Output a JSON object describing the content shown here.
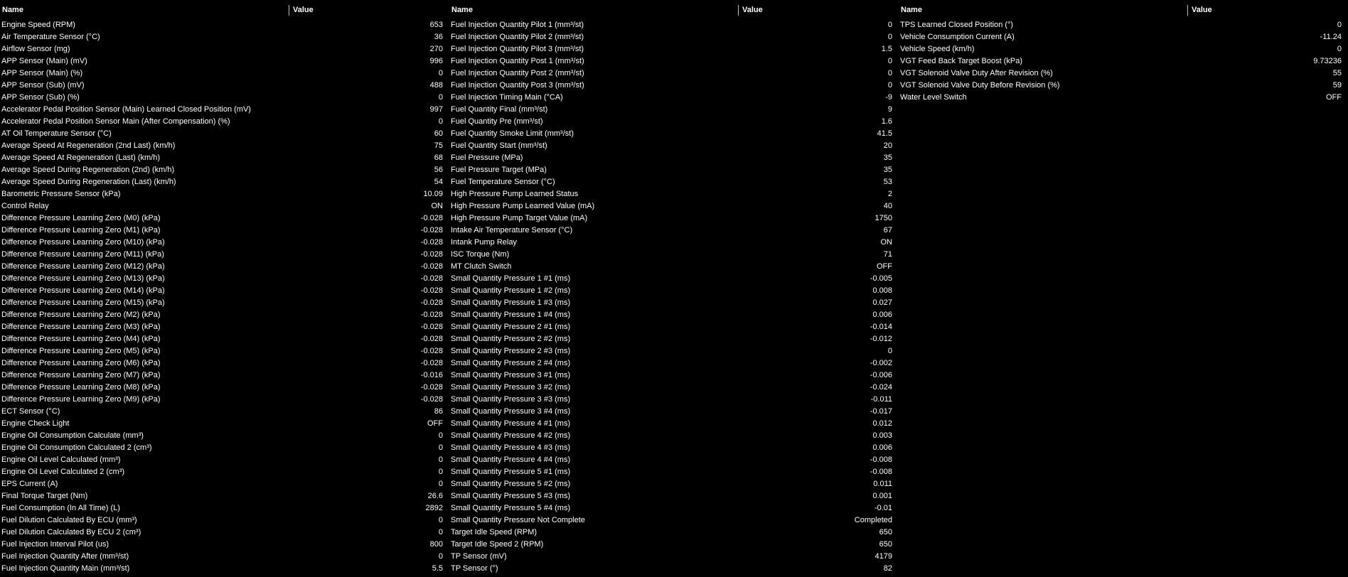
{
  "headers": {
    "name": "Name",
    "value": "Value"
  },
  "colors": {
    "background": "#000000",
    "text": "#ffffff"
  },
  "columns": [
    {
      "rows": [
        {
          "name": "Engine Speed (RPM)",
          "value": "653"
        },
        {
          "name": "Air Temperature Sensor (°C)",
          "value": "36"
        },
        {
          "name": "Airflow Sensor (mg)",
          "value": "270"
        },
        {
          "name": "APP Sensor (Main) (mV)",
          "value": "996"
        },
        {
          "name": "APP Sensor (Main) (%)",
          "value": "0"
        },
        {
          "name": "APP Sensor (Sub) (mV)",
          "value": "488"
        },
        {
          "name": "APP Sensor (Sub) (%)",
          "value": "0"
        },
        {
          "name": "Accelerator Pedal Position Sensor (Main) Learned Closed Position (mV)",
          "value": "997"
        },
        {
          "name": "Accelerator Pedal Position Sensor Main (After Compensation) (%)",
          "value": "0"
        },
        {
          "name": "AT Oil Temperature Sensor (°C)",
          "value": "60"
        },
        {
          "name": "Average Speed At Regeneration (2nd Last) (km/h)",
          "value": "75"
        },
        {
          "name": "Average Speed At Regeneration (Last) (km/h)",
          "value": "68"
        },
        {
          "name": "Average Speed During Regeneration (2nd) (km/h)",
          "value": "56"
        },
        {
          "name": "Average Speed During Regeneration (Last) (km/h)",
          "value": "54"
        },
        {
          "name": "Barometric Pressure Sensor (kPa)",
          "value": "10.09"
        },
        {
          "name": "Control Relay",
          "value": "ON"
        },
        {
          "name": "Difference Pressure Learning Zero (M0) (kPa)",
          "value": "-0.028"
        },
        {
          "name": "Difference Pressure Learning Zero (M1) (kPa)",
          "value": "-0.028"
        },
        {
          "name": "Difference Pressure Learning Zero (M10) (kPa)",
          "value": "-0.028"
        },
        {
          "name": "Difference Pressure Learning Zero (M11) (kPa)",
          "value": "-0.028"
        },
        {
          "name": "Difference Pressure Learning Zero (M12) (kPa)",
          "value": "-0.028"
        },
        {
          "name": "Difference Pressure Learning Zero (M13) (kPa)",
          "value": "-0.028"
        },
        {
          "name": "Difference Pressure Learning Zero (M14) (kPa)",
          "value": "-0.028"
        },
        {
          "name": "Difference Pressure Learning Zero (M15) (kPa)",
          "value": "-0.028"
        },
        {
          "name": "Difference Pressure Learning Zero (M2) (kPa)",
          "value": "-0.028"
        },
        {
          "name": "Difference Pressure Learning Zero (M3) (kPa)",
          "value": "-0.028"
        },
        {
          "name": "Difference Pressure Learning Zero (M4) (kPa)",
          "value": "-0.028"
        },
        {
          "name": "Difference Pressure Learning Zero (M5) (kPa)",
          "value": "-0.028"
        },
        {
          "name": "Difference Pressure Learning Zero (M6) (kPa)",
          "value": "-0.028"
        },
        {
          "name": "Difference Pressure Learning Zero (M7) (kPa)",
          "value": "-0.016"
        },
        {
          "name": "Difference Pressure Learning Zero (M8) (kPa)",
          "value": "-0.028"
        },
        {
          "name": "Difference Pressure Learning Zero (M9) (kPa)",
          "value": "-0.028"
        },
        {
          "name": "ECT Sensor (°C)",
          "value": "86"
        },
        {
          "name": "Engine Check Light",
          "value": "OFF"
        },
        {
          "name": "Engine Oil Consumption Calculate (mm³)",
          "value": "0"
        },
        {
          "name": "Engine Oil Consumption Calculated 2 (cm³)",
          "value": "0"
        },
        {
          "name": "Engine Oil Level Calculated (mm³)",
          "value": "0"
        },
        {
          "name": "Engine Oil Level Calculated 2 (cm³)",
          "value": "0"
        },
        {
          "name": "EPS Current (A)",
          "value": "0"
        },
        {
          "name": "Final Torque Target (Nm)",
          "value": "26.6"
        },
        {
          "name": "Fuel Consumption (In All Time) (L)",
          "value": "2892"
        },
        {
          "name": "Fuel Dilution Calculated By ECU (mm³)",
          "value": "0"
        },
        {
          "name": "Fuel Dilution Calculated By ECU 2 (cm³)",
          "value": "0"
        },
        {
          "name": "Fuel Injection Interval Pilot (us)",
          "value": "800"
        },
        {
          "name": "Fuel Injection Quantity After (mm³/st)",
          "value": "0"
        },
        {
          "name": "Fuel Injection Quantity Main (mm³/st)",
          "value": "5.5"
        }
      ]
    },
    {
      "rows": [
        {
          "name": "Fuel Injection Quantity Pilot 1 (mm³/st)",
          "value": "0"
        },
        {
          "name": "Fuel Injection Quantity Pilot 2 (mm³/st)",
          "value": "0"
        },
        {
          "name": "Fuel Injection Quantity Pilot 3 (mm³/st)",
          "value": "1.5"
        },
        {
          "name": "Fuel Injection Quantity Post 1 (mm³/st)",
          "value": "0"
        },
        {
          "name": "Fuel Injection Quantity Post 2 (mm³/st)",
          "value": "0"
        },
        {
          "name": "Fuel Injection Quantity Post 3 (mm³/st)",
          "value": "0"
        },
        {
          "name": "Fuel Injection Timing Main (°CA)",
          "value": "-9"
        },
        {
          "name": "Fuel Quantity Final (mm³/st)",
          "value": "9"
        },
        {
          "name": "Fuel Quantity Pre (mm³/st)",
          "value": "1.6"
        },
        {
          "name": "Fuel Quantity Smoke Limit (mm³/st)",
          "value": "41.5"
        },
        {
          "name": "Fuel Quantity Start (mm³/st)",
          "value": "20"
        },
        {
          "name": "Fuel Pressure (MPa)",
          "value": "35"
        },
        {
          "name": "Fuel Pressure Target (MPa)",
          "value": "35"
        },
        {
          "name": "Fuel Temperature Sensor (°C)",
          "value": "53"
        },
        {
          "name": "High Pressure Pump Learned Status",
          "value": "2"
        },
        {
          "name": "High Pressure Pump Learned Value (mA)",
          "value": "40"
        },
        {
          "name": "High Pressure Pump Target Value (mA)",
          "value": "1750"
        },
        {
          "name": "Intake Air Temperature Sensor (°C)",
          "value": "67"
        },
        {
          "name": "Intank Pump Relay",
          "value": "ON"
        },
        {
          "name": "ISC Torque (Nm)",
          "value": "71"
        },
        {
          "name": "MT Clutch Switch",
          "value": "OFF"
        },
        {
          "name": "Small Quantity Pressure 1 #1 (ms)",
          "value": "-0.005"
        },
        {
          "name": "Small Quantity Pressure 1 #2 (ms)",
          "value": "0.008"
        },
        {
          "name": "Small Quantity Pressure 1 #3 (ms)",
          "value": "0.027"
        },
        {
          "name": "Small Quantity Pressure 1 #4 (ms)",
          "value": "0.006"
        },
        {
          "name": "Small Quantity Pressure 2 #1 (ms)",
          "value": "-0.014"
        },
        {
          "name": "Small Quantity Pressure 2 #2 (ms)",
          "value": "-0.012"
        },
        {
          "name": "Small Quantity Pressure 2 #3 (ms)",
          "value": "0"
        },
        {
          "name": "Small Quantity Pressure 2 #4 (ms)",
          "value": "-0.002"
        },
        {
          "name": "Small Quantity Pressure 3 #1 (ms)",
          "value": "-0.006"
        },
        {
          "name": "Small Quantity Pressure 3 #2 (ms)",
          "value": "-0.024"
        },
        {
          "name": "Small Quantity Pressure 3 #3 (ms)",
          "value": "-0.011"
        },
        {
          "name": "Small Quantity Pressure 3 #4 (ms)",
          "value": "-0.017"
        },
        {
          "name": "Small Quantity Pressure 4 #1 (ms)",
          "value": "0.012"
        },
        {
          "name": "Small Quantity Pressure 4 #2 (ms)",
          "value": "0.003"
        },
        {
          "name": "Small Quantity Pressure 4 #3 (ms)",
          "value": "0.006"
        },
        {
          "name": "Small Quantity Pressure 4 #4 (ms)",
          "value": "-0.008"
        },
        {
          "name": "Small Quantity Pressure 5 #1 (ms)",
          "value": "-0.008"
        },
        {
          "name": "Small Quantity Pressure 5 #2 (ms)",
          "value": "0.011"
        },
        {
          "name": "Small Quantity Pressure 5 #3 (ms)",
          "value": "0.001"
        },
        {
          "name": "Small Quantity Pressure 5 #4 (ms)",
          "value": "-0.01"
        },
        {
          "name": "Small Quantity Pressure Not Complete",
          "value": "Completed"
        },
        {
          "name": "Target Idle Speed (RPM)",
          "value": "650"
        },
        {
          "name": "Target Idle Speed 2 (RPM)",
          "value": "650"
        },
        {
          "name": "TP Sensor (mV)",
          "value": "4179"
        },
        {
          "name": "TP Sensor (°)",
          "value": "82"
        }
      ]
    },
    {
      "rows": [
        {
          "name": "TPS Learned Closed Position (°)",
          "value": "0"
        },
        {
          "name": "Vehicle Consumption Current (A)",
          "value": "-11.24"
        },
        {
          "name": "Vehicle Speed (km/h)",
          "value": "0"
        },
        {
          "name": "VGT Feed Back Target Boost (kPa)",
          "value": "9.73236"
        },
        {
          "name": "VGT Solenoid Valve Duty After Revision (%)",
          "value": "55"
        },
        {
          "name": "VGT Solenoid Valve Duty Before Revision (%)",
          "value": "59"
        },
        {
          "name": "Water Level Switch",
          "value": "OFF"
        }
      ]
    }
  ]
}
